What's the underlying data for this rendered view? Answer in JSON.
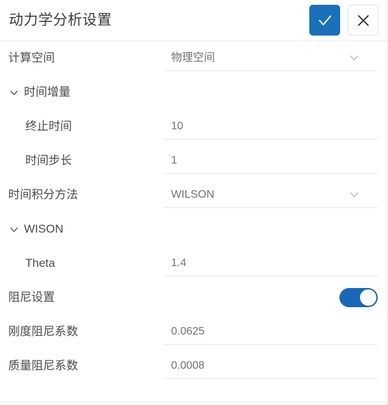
{
  "header": {
    "title": "动力学分析设置",
    "confirm_label": "确认",
    "confirm_icon": "check-icon",
    "cancel_label": "取消",
    "cancel_icon": "close-icon",
    "confirm_color": "#1a71ba"
  },
  "colors": {
    "accent": "#1a71ba",
    "toggle_on": "#1868b7",
    "label_text": "#4a4a4a",
    "value_text": "#6f7276",
    "divider": "#e8e8e8"
  },
  "rows": [
    {
      "label": "计算空间",
      "type": "select",
      "value": "物理空间",
      "indent": false,
      "name": "compute-space"
    },
    {
      "label": "时间增量",
      "type": "group",
      "expanded": true,
      "indent": false,
      "name": "time-increment"
    },
    {
      "label": "终止时间",
      "type": "text",
      "value": "10",
      "indent": true,
      "name": "end-time"
    },
    {
      "label": "时间步长",
      "type": "text",
      "value": "1",
      "indent": true,
      "name": "time-step"
    },
    {
      "label": "时间积分方法",
      "type": "select",
      "value": "WILSON",
      "indent": false,
      "name": "time-integration-method"
    },
    {
      "label": "WISON",
      "type": "group",
      "expanded": true,
      "indent": false,
      "name": "wison"
    },
    {
      "label": "Theta",
      "type": "text",
      "value": "1.4",
      "indent": true,
      "name": "theta"
    },
    {
      "label": "阻尼设置",
      "type": "toggle",
      "value": "on",
      "indent": false,
      "name": "damping-settings"
    },
    {
      "label": "刚度阻尼系数",
      "type": "text",
      "value": "0.0625",
      "indent": false,
      "name": "stiffness-damping-coefficient"
    },
    {
      "label": "质量阻尼系数",
      "type": "text",
      "value": "0.0008",
      "indent": false,
      "name": "mass-damping-coefficient"
    }
  ]
}
